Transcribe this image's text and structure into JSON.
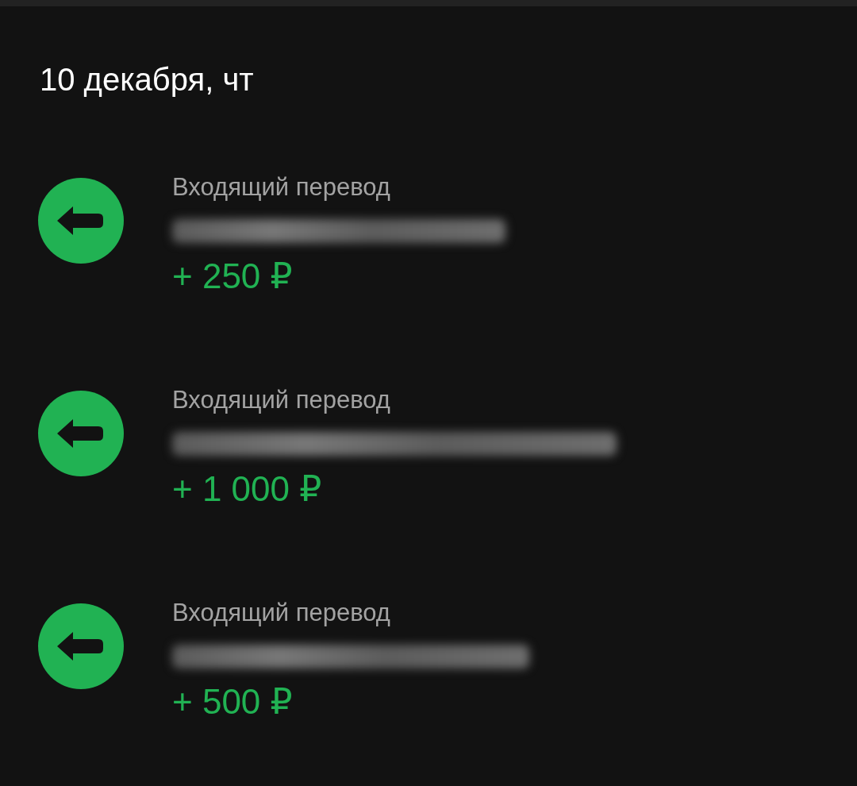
{
  "date_heading": "10 декабря, чт",
  "transactions": [
    {
      "kind": "incoming",
      "title": "Входящий перевод",
      "amount": "+ 250 ₽"
    },
    {
      "kind": "incoming",
      "title": "Входящий перевод",
      "amount": "+ 1 000 ₽"
    },
    {
      "kind": "incoming",
      "title": "Входящий перевод",
      "amount": "+ 500 ₽"
    }
  ]
}
